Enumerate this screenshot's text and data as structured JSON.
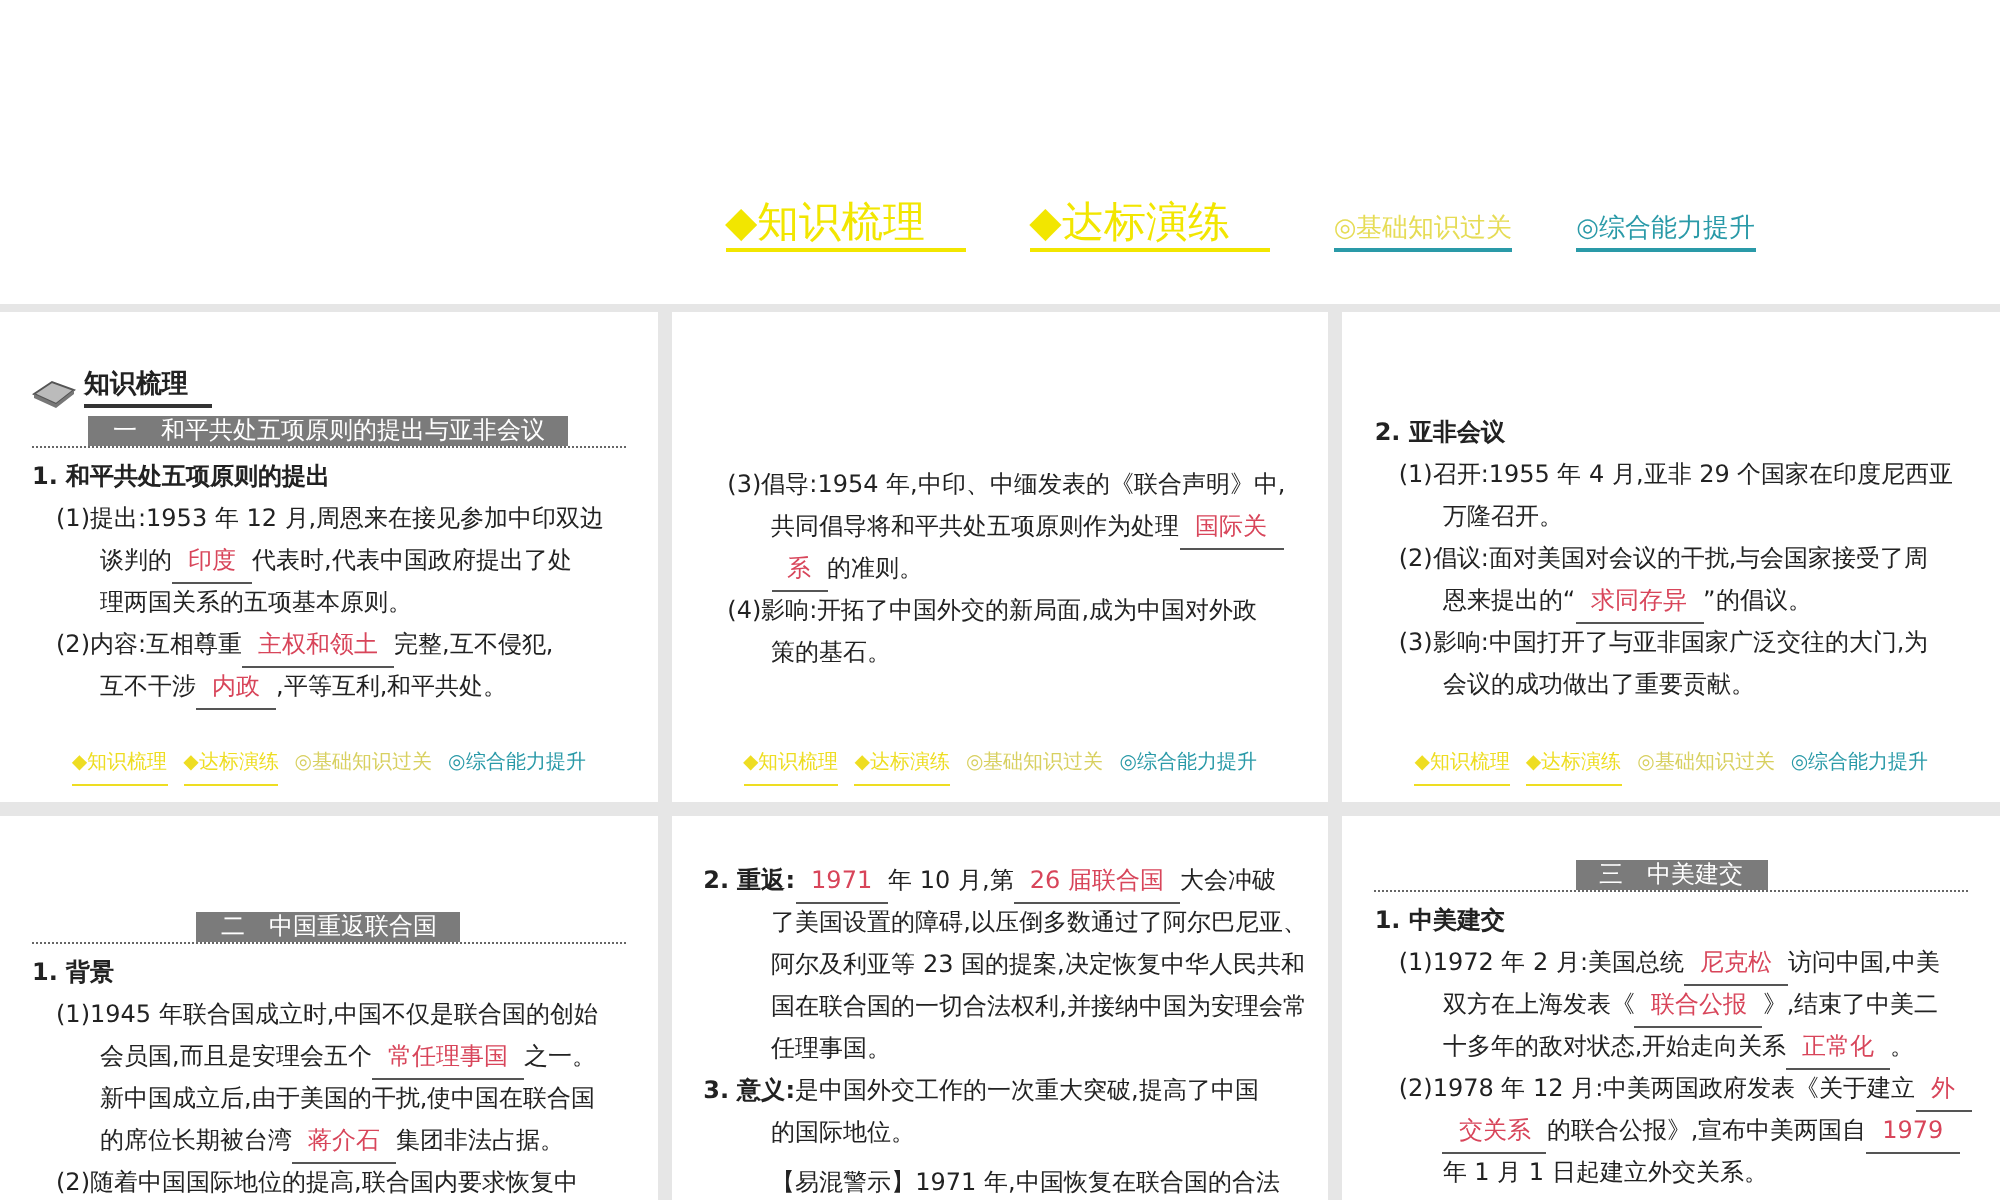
{
  "nav": [
    {
      "text": "◆知识梳理",
      "kind": "primary",
      "color": "#f2e600"
    },
    {
      "text": "◆达标演练",
      "kind": "primary",
      "color": "#f2e600"
    },
    {
      "text": "◎基础知识过关",
      "kind": "secondary",
      "color": "#e6dc55"
    },
    {
      "text": "◎综合能力提升",
      "kind": "secondary",
      "color": "#2a9aa8"
    }
  ],
  "slides": [
    {
      "lines": [
        {
          "kind": "logo",
          "parts": [
            {
              "kind": "text",
              "text": "知识梳理"
            }
          ]
        },
        {
          "kind": "banner",
          "parts": [
            {
              "kind": "text",
              "text": "一　和平共处五项原则的提出与亚非会议"
            }
          ]
        },
        {
          "kind": "heading",
          "parts": [
            {
              "kind": "text",
              "text": "1. 和平共处五项原则的提出"
            }
          ]
        },
        {
          "kind": "item",
          "parts": [
            {
              "kind": "text",
              "text": "(1)提出:1953 年 12 月,周恩来在接见参加中印双边"
            }
          ]
        },
        {
          "kind": "cont",
          "parts": [
            {
              "kind": "text",
              "text": "谈判的"
            },
            {
              "kind": "blank",
              "text": "印度"
            },
            {
              "kind": "text",
              "text": "代表时,代表中国政府提出了处"
            }
          ]
        },
        {
          "kind": "cont",
          "parts": [
            {
              "kind": "text",
              "text": "理两国关系的五项基本原则。"
            }
          ]
        },
        {
          "kind": "item",
          "parts": [
            {
              "kind": "text",
              "text": "(2)内容:互相尊重"
            },
            {
              "kind": "blank",
              "text": "主权和领土"
            },
            {
              "kind": "text",
              "text": "完整,互不侵犯,"
            }
          ]
        },
        {
          "kind": "cont",
          "parts": [
            {
              "kind": "text",
              "text": "互不干涉"
            },
            {
              "kind": "blank",
              "text": "内政"
            },
            {
              "kind": "text",
              "text": ",平等互利,和平共处。"
            }
          ]
        }
      ],
      "footer": [
        "◆知识梳理",
        "◆达标演练",
        "◎基础知识过关",
        "◎综合能力提升"
      ]
    },
    {
      "lines": [
        {
          "kind": "item",
          "parts": [
            {
              "kind": "text",
              "text": "(3)倡导:1954 年,中印、中缅发表的《联合声明》中,"
            }
          ]
        },
        {
          "kind": "cont",
          "parts": [
            {
              "kind": "text",
              "text": "共同倡导将和平共处五项原则作为处理"
            },
            {
              "kind": "blank",
              "text": "国际关"
            }
          ]
        },
        {
          "kind": "cont",
          "parts": [
            {
              "kind": "blank",
              "text": "系"
            },
            {
              "kind": "text",
              "text": "的准则。"
            }
          ]
        },
        {
          "kind": "item",
          "parts": [
            {
              "kind": "text",
              "text": "(4)影响:开拓了中国外交的新局面,成为中国对外政"
            }
          ]
        },
        {
          "kind": "cont",
          "parts": [
            {
              "kind": "text",
              "text": "策的基石。"
            }
          ]
        }
      ],
      "footer": [
        "◆知识梳理",
        "◆达标演练",
        "◎基础知识过关",
        "◎综合能力提升"
      ]
    },
    {
      "lines": [
        {
          "kind": "heading",
          "parts": [
            {
              "kind": "text",
              "text": "2. 亚非会议"
            }
          ]
        },
        {
          "kind": "item",
          "parts": [
            {
              "kind": "text",
              "text": "(1)召开:1955 年 4 月,亚非 29 个国家在印度尼西亚"
            }
          ]
        },
        {
          "kind": "cont",
          "parts": [
            {
              "kind": "text",
              "text": "万隆召开。"
            }
          ]
        },
        {
          "kind": "item",
          "parts": [
            {
              "kind": "text",
              "text": "(2)倡议:面对美国对会议的干扰,与会国家接受了周"
            }
          ]
        },
        {
          "kind": "cont",
          "parts": [
            {
              "kind": "text",
              "text": "恩来提出的“"
            },
            {
              "kind": "blank",
              "text": "求同存异"
            },
            {
              "kind": "text",
              "text": "”的倡议。"
            }
          ]
        },
        {
          "kind": "item",
          "parts": [
            {
              "kind": "text",
              "text": "(3)影响:中国打开了与亚非国家广泛交往的大门,为"
            }
          ]
        },
        {
          "kind": "cont",
          "parts": [
            {
              "kind": "text",
              "text": "会议的成功做出了重要贡献。"
            }
          ]
        }
      ],
      "footer": [
        "◆知识梳理",
        "◆达标演练",
        "◎基础知识过关",
        "◎综合能力提升"
      ]
    },
    {
      "lines": [
        {
          "kind": "banner",
          "parts": [
            {
              "kind": "text",
              "text": "二　中国重返联合国"
            }
          ]
        },
        {
          "kind": "heading",
          "parts": [
            {
              "kind": "text",
              "text": "1. 背景"
            }
          ]
        },
        {
          "kind": "item",
          "parts": [
            {
              "kind": "text",
              "text": "(1)1945 年联合国成立时,中国不仅是联合国的创始"
            }
          ]
        },
        {
          "kind": "cont",
          "parts": [
            {
              "kind": "text",
              "text": "会员国,而且是安理会五个"
            },
            {
              "kind": "blank",
              "text": "常任理事国"
            },
            {
              "kind": "text",
              "text": "之一。"
            }
          ]
        },
        {
          "kind": "cont",
          "parts": [
            {
              "kind": "text",
              "text": "新中国成立后,由于美国的干扰,使中国在联合国"
            }
          ]
        },
        {
          "kind": "cont",
          "parts": [
            {
              "kind": "text",
              "text": "的席位长期被台湾"
            },
            {
              "kind": "blank",
              "text": "蒋介石"
            },
            {
              "kind": "text",
              "text": "集团非法占据。"
            }
          ]
        },
        {
          "kind": "item",
          "parts": [
            {
              "kind": "text",
              "text": "(2)随着中国国际地位的提高,联合国内要求恢复中"
            }
          ]
        }
      ]
    },
    {
      "lines": [
        {
          "kind": "heading",
          "parts": [
            {
              "kind": "text",
              "text": "2. 重返:"
            },
            {
              "kind": "blank",
              "text": "1971"
            },
            {
              "kind": "text",
              "text": "年 10 月,第"
            },
            {
              "kind": "blank",
              "text": "26 届联合国"
            },
            {
              "kind": "text",
              "text": "大会冲破"
            }
          ]
        },
        {
          "kind": "cont",
          "parts": [
            {
              "kind": "text",
              "text": "了美国设置的障碍,以压倒多数通过了阿尔巴尼亚、"
            }
          ]
        },
        {
          "kind": "cont",
          "parts": [
            {
              "kind": "text",
              "text": "阿尔及利亚等 23 国的提案,决定恢复中华人民共和"
            }
          ]
        },
        {
          "kind": "cont",
          "parts": [
            {
              "kind": "text",
              "text": "国在联合国的一切合法权利,并接纳中国为安理会常"
            }
          ]
        },
        {
          "kind": "cont",
          "parts": [
            {
              "kind": "text",
              "text": "任理事国。"
            }
          ]
        },
        {
          "kind": "heading",
          "parts": [
            {
              "kind": "text",
              "text": "3. 意义:"
            },
            {
              "kind": "text",
              "text": "是中国外交工作的一次重大突破,提高了中国"
            }
          ]
        },
        {
          "kind": "cont",
          "parts": [
            {
              "kind": "text",
              "text": "的国际地位。"
            }
          ]
        },
        {
          "kind": "note",
          "parts": [
            {
              "kind": "text",
              "text": "【易混警示】1971 年,中国恢复在联合国的合法"
            }
          ]
        }
      ]
    },
    {
      "lines": [
        {
          "kind": "banner",
          "parts": [
            {
              "kind": "text",
              "text": "三　中美建交"
            }
          ]
        },
        {
          "kind": "heading",
          "parts": [
            {
              "kind": "text",
              "text": "1. 中美建交"
            }
          ]
        },
        {
          "kind": "item",
          "parts": [
            {
              "kind": "text",
              "text": "(1)1972 年 2 月:美国总统"
            },
            {
              "kind": "blank",
              "text": "尼克松"
            },
            {
              "kind": "text",
              "text": "访问中国,中美"
            }
          ]
        },
        {
          "kind": "cont",
          "parts": [
            {
              "kind": "text",
              "text": "双方在上海发表《"
            },
            {
              "kind": "blank",
              "text": "联合公报"
            },
            {
              "kind": "text",
              "text": "》,结束了中美二"
            }
          ]
        },
        {
          "kind": "cont",
          "parts": [
            {
              "kind": "text",
              "text": "十多年的敌对状态,开始走向关系"
            },
            {
              "kind": "blank",
              "text": "正常化"
            },
            {
              "kind": "text",
              "text": "。"
            }
          ]
        },
        {
          "kind": "item",
          "parts": [
            {
              "kind": "text",
              "text": "(2)1978 年 12 月:中美两国政府发表《关于建立"
            },
            {
              "kind": "blank",
              "text": "外"
            }
          ]
        },
        {
          "kind": "cont",
          "parts": [
            {
              "kind": "blank",
              "text": "交关系"
            },
            {
              "kind": "text",
              "text": "的联合公报》,宣布中美两国自"
            },
            {
              "kind": "blank",
              "text": "1979"
            }
          ]
        },
        {
          "kind": "cont",
          "parts": [
            {
              "kind": "text",
              "text": "年 1 月 1 日起建立外交关系。"
            }
          ]
        }
      ]
    }
  ]
}
